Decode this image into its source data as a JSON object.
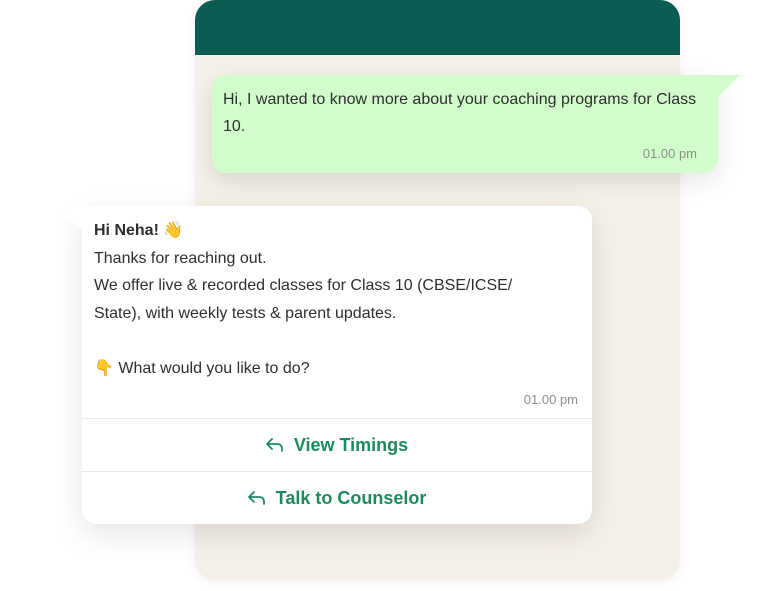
{
  "outgoing": {
    "text": "Hi, I wanted to know more about your coaching programs for Class 10.",
    "time": "01.00 pm"
  },
  "incoming": {
    "greeting": "Hi Neha! 👋",
    "line1": "Thanks for reaching out.",
    "line2": "We offer live & recorded classes for Class 10 (CBSE/ICSE/",
    "line3": "State), with weekly tests & parent updates.",
    "question": "👇 What would you like to do?",
    "time": "01.00 pm"
  },
  "quick_replies": [
    {
      "label": "View Timings",
      "icon": "reply-arrow-icon"
    },
    {
      "label": "Talk to Counselor",
      "icon": "reply-arrow-icon"
    }
  ],
  "colors": {
    "header": "#0b5c52",
    "chat_background": "#f4efe7",
    "outgoing_bubble": "#d1fdcb",
    "accent": "#1d8a5e"
  }
}
